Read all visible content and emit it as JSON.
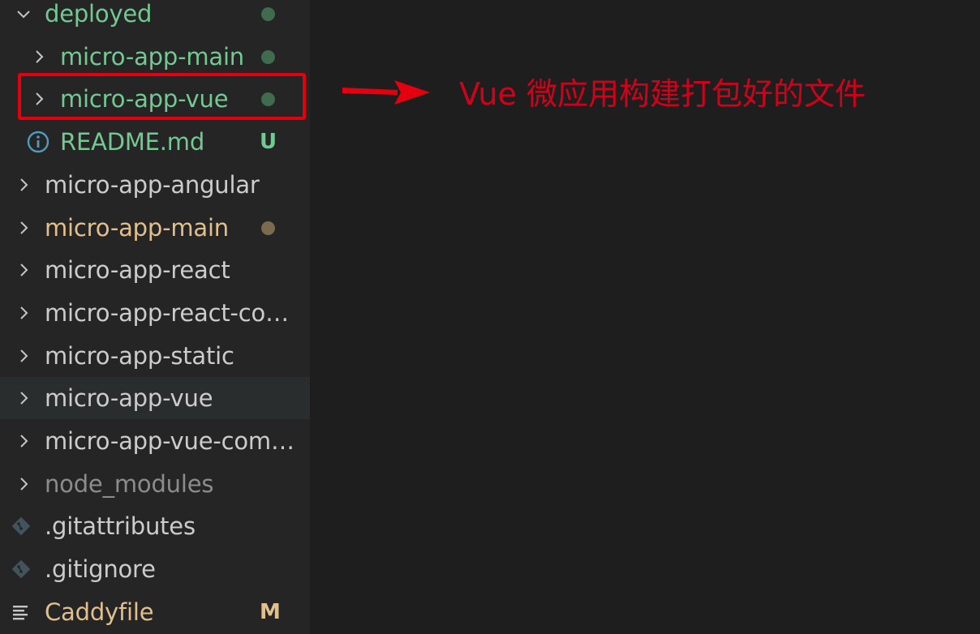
{
  "colors": {
    "sidebar_bg": "#252526",
    "editor_bg": "#1e1e1e",
    "text_default": "#cccccc",
    "text_untracked": "#73c991",
    "text_modified": "#e2c08d",
    "text_ignored": "#8c8c8c",
    "dot_green": "#3f6b4e",
    "dot_brown": "#7b6a4e",
    "annotation_red": "#d0021b"
  },
  "explorer": {
    "items": [
      {
        "label": "deployed",
        "type": "folder",
        "expanded": true,
        "indent": 0,
        "status": "untracked-dot",
        "icon": "chevron-down-icon"
      },
      {
        "label": "micro-app-main",
        "type": "folder",
        "expanded": false,
        "indent": 1,
        "status": "untracked-dot",
        "icon": "chevron-right-icon"
      },
      {
        "label": "micro-app-vue",
        "type": "folder",
        "expanded": false,
        "indent": 1,
        "status": "untracked-dot",
        "icon": "chevron-right-icon"
      },
      {
        "label": "README.md",
        "type": "file",
        "indent": 1,
        "status": "untracked",
        "badge": "U",
        "icon": "info-icon"
      },
      {
        "label": "micro-app-angular",
        "type": "folder",
        "expanded": false,
        "indent": 0,
        "status": "none",
        "icon": "chevron-right-icon"
      },
      {
        "label": "micro-app-main",
        "type": "folder",
        "expanded": false,
        "indent": 0,
        "status": "modified-dot",
        "icon": "chevron-right-icon"
      },
      {
        "label": "micro-app-react",
        "type": "folder",
        "expanded": false,
        "indent": 0,
        "status": "none",
        "icon": "chevron-right-icon"
      },
      {
        "label": "micro-app-react-com...",
        "type": "folder",
        "expanded": false,
        "indent": 0,
        "status": "none",
        "icon": "chevron-right-icon"
      },
      {
        "label": "micro-app-static",
        "type": "folder",
        "expanded": false,
        "indent": 0,
        "status": "none",
        "icon": "chevron-right-icon"
      },
      {
        "label": "micro-app-vue",
        "type": "folder",
        "expanded": false,
        "indent": 0,
        "status": "none",
        "hovered": true,
        "icon": "chevron-right-icon"
      },
      {
        "label": "micro-app-vue-comm...",
        "type": "folder",
        "expanded": false,
        "indent": 0,
        "status": "none",
        "icon": "chevron-right-icon"
      },
      {
        "label": "node_modules",
        "type": "folder",
        "expanded": false,
        "indent": 0,
        "status": "ignored",
        "icon": "chevron-right-icon"
      },
      {
        "label": ".gitattributes",
        "type": "file",
        "indent": 0,
        "status": "none",
        "icon": "git-icon"
      },
      {
        "label": ".gitignore",
        "type": "file",
        "indent": 0,
        "status": "none",
        "icon": "git-icon"
      },
      {
        "label": "Caddyfile",
        "type": "file",
        "indent": 0,
        "status": "modified",
        "badge": "M",
        "icon": "lines-icon"
      }
    ]
  },
  "annotation": {
    "text": "Vue 微应用构建打包好的文件"
  }
}
